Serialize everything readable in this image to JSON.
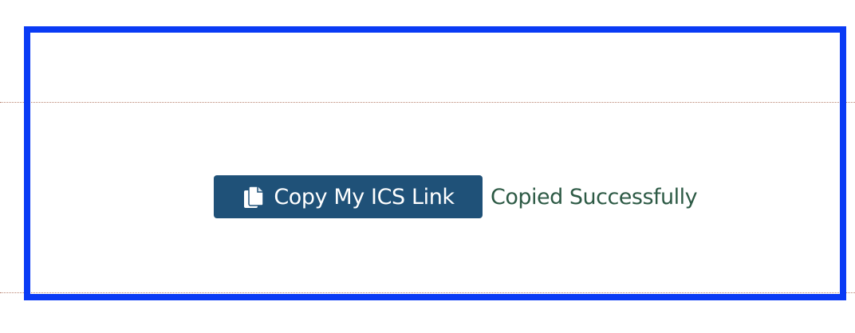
{
  "copy_section": {
    "button_label": "Copy My ICS Link",
    "button_icon": "copy-icon",
    "status_message": "Copied Successfully",
    "colors": {
      "button_background": "#1f5178",
      "button_text": "#ffffff",
      "status_text": "#2d5a45",
      "highlight_border": "#0a3bf5"
    }
  }
}
